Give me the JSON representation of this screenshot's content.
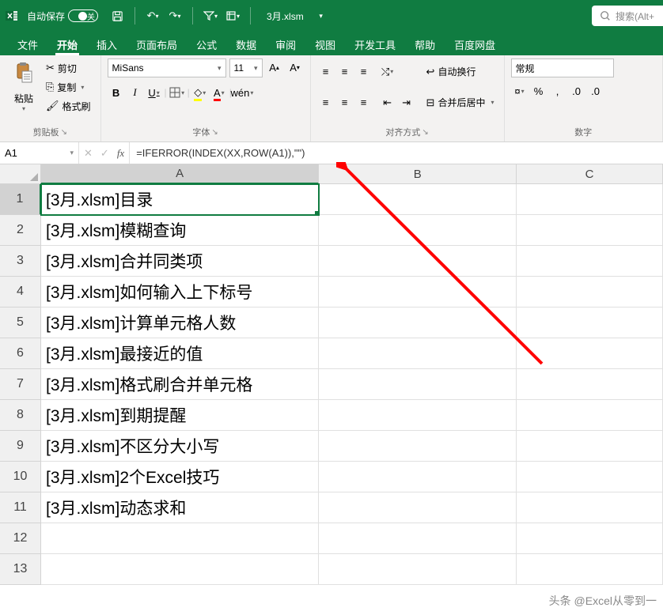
{
  "titlebar": {
    "autosave_label": "自动保存",
    "toggle_state": "关",
    "filename": "3月.xlsm",
    "search_placeholder": "搜索(Alt+"
  },
  "ribbon_tabs": [
    "文件",
    "开始",
    "插入",
    "页面布局",
    "公式",
    "数据",
    "审阅",
    "视图",
    "开发工具",
    "帮助",
    "百度网盘"
  ],
  "ribbon_active_tab": 1,
  "ribbon": {
    "clipboard": {
      "paste": "粘贴",
      "cut": "剪切",
      "copy": "复制",
      "format_painter": "格式刷",
      "group_label": "剪贴板"
    },
    "font": {
      "name": "MiSans",
      "size": "11",
      "group_label": "字体",
      "bold": "B",
      "italic": "I",
      "underline": "U",
      "wen": "wén"
    },
    "alignment": {
      "wrap_text": "自动换行",
      "merge_center": "合并后居中",
      "group_label": "对齐方式"
    },
    "number": {
      "format": "常规",
      "group_label": "数字"
    }
  },
  "name_box": "A1",
  "formula": "=IFERROR(INDEX(XX,ROW(A1)),\"\")",
  "col_headers": [
    "A",
    "B",
    "C"
  ],
  "rows": [
    {
      "n": 1,
      "a": "[3月.xlsm]目录"
    },
    {
      "n": 2,
      "a": "[3月.xlsm]模糊查询"
    },
    {
      "n": 3,
      "a": "[3月.xlsm]合并同类项"
    },
    {
      "n": 4,
      "a": "[3月.xlsm]如何输入上下标号"
    },
    {
      "n": 5,
      "a": "[3月.xlsm]计算单元格人数"
    },
    {
      "n": 6,
      "a": "[3月.xlsm]最接近的值"
    },
    {
      "n": 7,
      "a": "[3月.xlsm]格式刷合并单元格"
    },
    {
      "n": 8,
      "a": "[3月.xlsm]到期提醒"
    },
    {
      "n": 9,
      "a": "[3月.xlsm]不区分大小写"
    },
    {
      "n": 10,
      "a": "[3月.xlsm]2个Excel技巧"
    },
    {
      "n": 11,
      "a": "[3月.xlsm]动态求和"
    },
    {
      "n": 12,
      "a": ""
    },
    {
      "n": 13,
      "a": ""
    }
  ],
  "watermark": "头条 @Excel从零到一"
}
